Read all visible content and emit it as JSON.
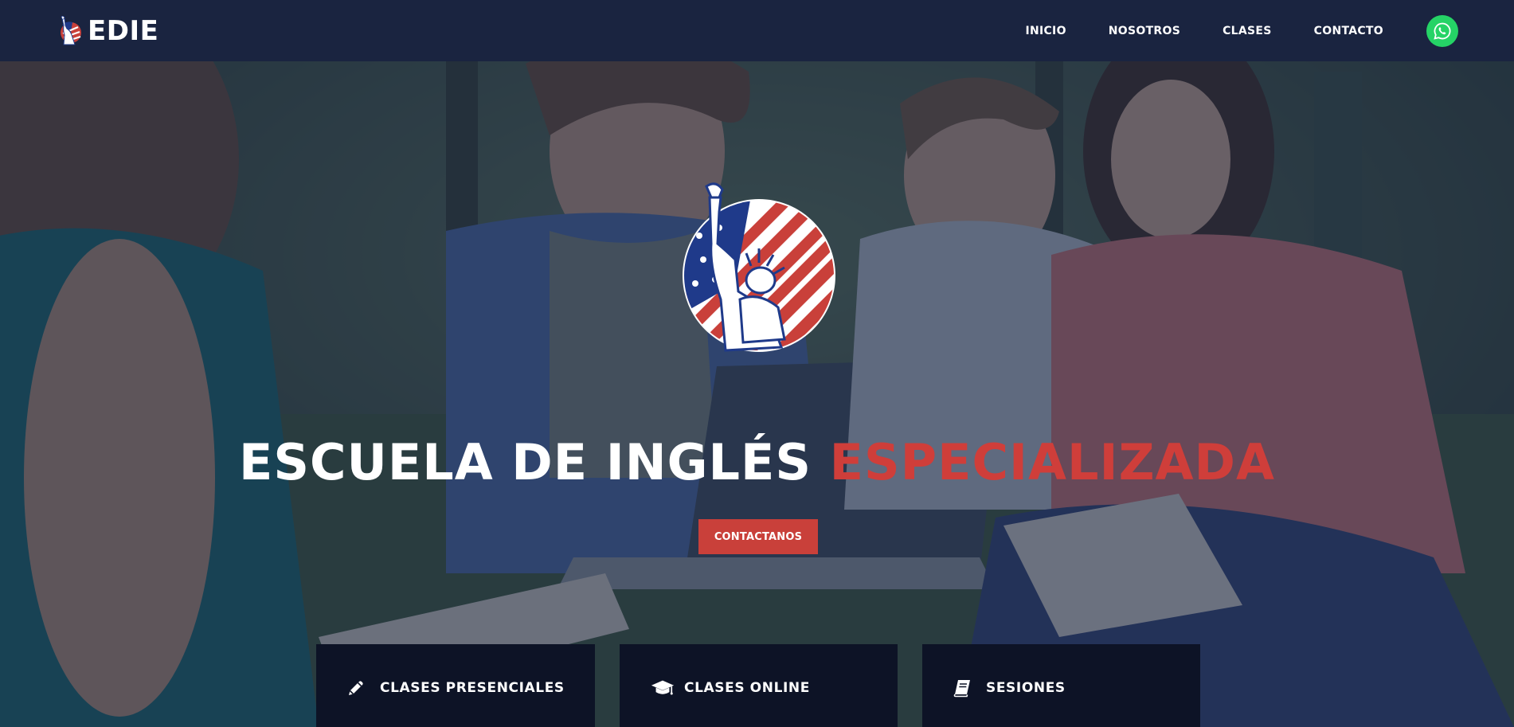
{
  "header": {
    "brand_name": "EDIE",
    "nav": [
      {
        "label": "INICIO"
      },
      {
        "label": "NOSOTROS"
      },
      {
        "label": "CLASES"
      },
      {
        "label": "CONTACTO"
      }
    ],
    "whatsapp_icon": "whatsapp-icon"
  },
  "hero": {
    "title_white": "ESCUELA DE INGLÉS",
    "title_red": "ESPECIALIZADA",
    "cta_label": "CONTACTANOS",
    "logo": "statue-of-liberty-flag-logo"
  },
  "cards": [
    {
      "icon": "pencil-icon",
      "label": "CLASES PRESENCIALES"
    },
    {
      "icon": "graduation-cap-icon",
      "label": "CLASES ONLINE"
    },
    {
      "icon": "book-icon",
      "label": "SESIONES"
    }
  ],
  "colors": {
    "navbar": "#1a2440",
    "accent_red": "#cf3e3a",
    "whatsapp_green": "#25d366",
    "card_bg": "#0d1326",
    "overlay": "rgba(30,42,70,0.62)"
  }
}
